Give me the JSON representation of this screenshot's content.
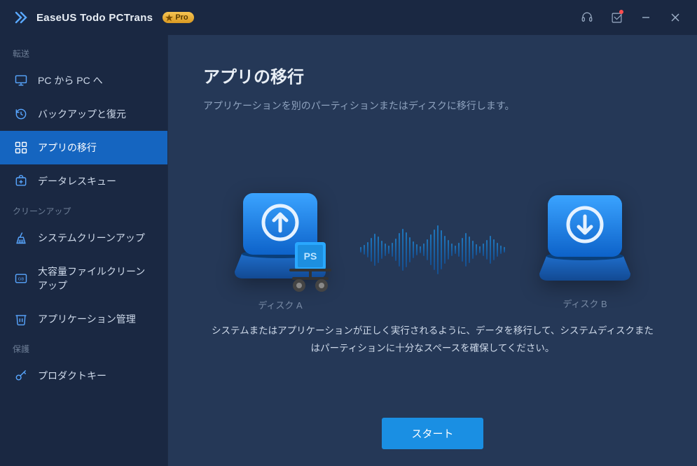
{
  "titlebar": {
    "brand": "EaseUS Todo PCTrans",
    "badge": "Pro"
  },
  "sidebar": {
    "section_transfer": "転送",
    "section_cleanup": "クリーンアップ",
    "section_protect": "保護",
    "items": {
      "pc_to_pc": "PC から PC へ",
      "backup_restore": "バックアップと復元",
      "app_migration": "アプリの移行",
      "data_rescue": "データレスキュー",
      "system_cleanup": "システムクリーンアップ",
      "large_file_cleanup": "大容量ファイルクリーンアップ",
      "app_management": "アプリケーション管理",
      "product_key": "プロダクトキー"
    }
  },
  "main": {
    "title": "アプリの移行",
    "subtitle": "アプリケーションを別のパーティションまたはディスクに移行します。",
    "disk_a": "ディスク A",
    "disk_b": "ディスク B",
    "hint": "システムまたはアプリケーションが正しく実行されるように、データを移行して、システムディスクまたはパーティションに十分なスペースを確保してください。",
    "start": "スタート"
  }
}
